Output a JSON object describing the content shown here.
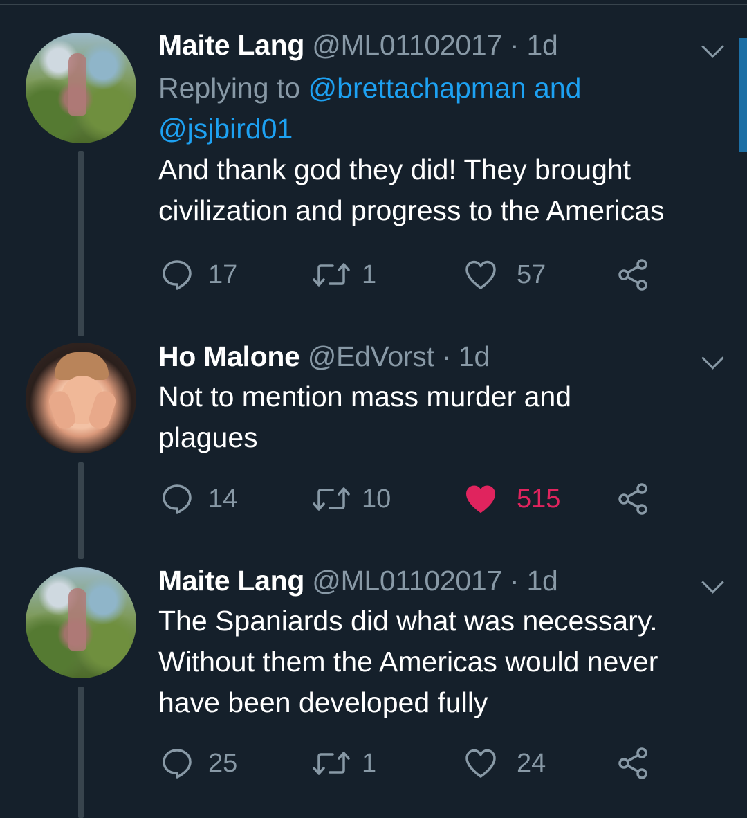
{
  "tweets": [
    {
      "name": "Maite Lang",
      "handle": "@ML01102017",
      "separator": "·",
      "time": "1d",
      "replying_prefix": "Replying to",
      "replying_users": "@brettachapman and",
      "replying_users_2": "@jsjbird01",
      "text": "And thank god they did! They brought civilization and progress to the Americas",
      "replies": "17",
      "retweets": "1",
      "likes": "57",
      "liked": false
    },
    {
      "name": "Ho Malone",
      "handle": "@EdVorst",
      "separator": "·",
      "time": "1d",
      "text": "Not to mention mass murder and plagues",
      "replies": "14",
      "retweets": "10",
      "likes": "515",
      "liked": true
    },
    {
      "name": "Maite Lang",
      "handle": "@ML01102017",
      "separator": "·",
      "time": "1d",
      "text": "The Spaniards did what was necessary. Without them the Americas would never have been developed fully",
      "replies": "25",
      "retweets": "1",
      "likes": "24",
      "liked": false
    }
  ],
  "colors": {
    "background": "#15202b",
    "secondary_text": "#8899a6",
    "link": "#1da1f2",
    "like": "#e0245e",
    "thread_line": "#38444d"
  },
  "icons": [
    "reply-icon",
    "retweet-icon",
    "like-icon",
    "share-icon",
    "chevron-down-icon"
  ]
}
